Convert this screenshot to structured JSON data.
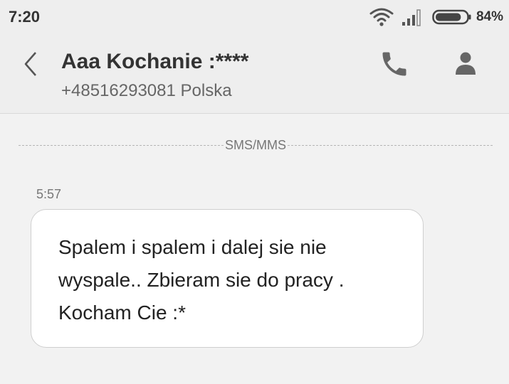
{
  "status_bar": {
    "time": "7:20",
    "battery_percent": "84%",
    "battery_level": 0.84,
    "icons": [
      "wifi-icon",
      "signal-icon",
      "battery-icon"
    ]
  },
  "header": {
    "contact_name": "Aaa Kochanie :****",
    "contact_subtitle": "+48516293081 Polska",
    "icons": [
      "back-chevron-icon",
      "phone-icon",
      "person-icon"
    ]
  },
  "conversation": {
    "channel_label": "SMS/MMS",
    "messages": [
      {
        "time": "5:57",
        "text": "Spalem i spalem i dalej sie nie\nwyspale.. Zbieram sie do pracy .\nKocham Cie :*"
      }
    ]
  },
  "colors": {
    "background": "#f2f2f2",
    "header_background": "#eeeeee",
    "bubble_background": "#ffffff",
    "bubble_border": "#cfcfcf",
    "icon_color": "#666666"
  }
}
